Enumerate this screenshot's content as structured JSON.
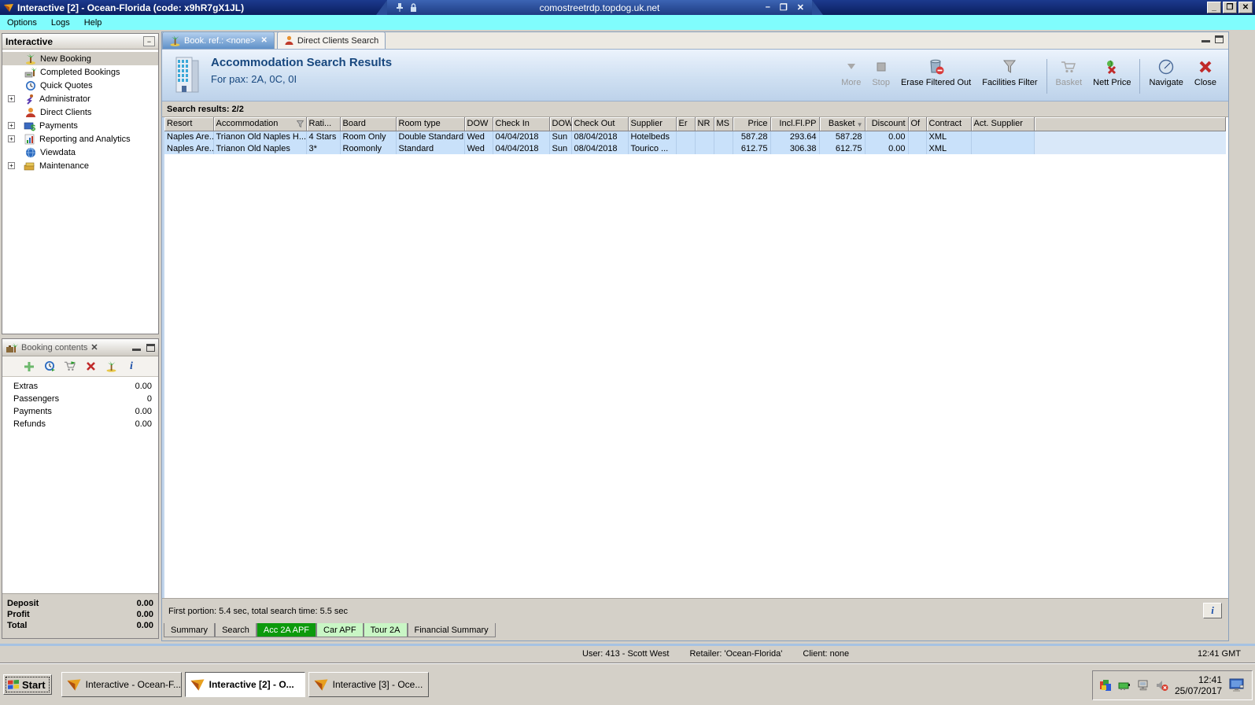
{
  "window": {
    "title": "Interactive [2] - Ocean-Florida (code: x9hR7gX1JL)"
  },
  "rdp": {
    "host": "comostreetrdp.topdog.uk.net"
  },
  "menu": {
    "items": [
      "Options",
      "Logs",
      "Help"
    ]
  },
  "sidebar": {
    "title": "Interactive",
    "items": [
      {
        "label": "New Booking"
      },
      {
        "label": "Completed Bookings"
      },
      {
        "label": "Quick Quotes"
      },
      {
        "label": "Administrator"
      },
      {
        "label": "Direct Clients"
      },
      {
        "label": "Payments"
      },
      {
        "label": "Reporting and Analytics"
      },
      {
        "label": "Viewdata"
      },
      {
        "label": "Maintenance"
      }
    ]
  },
  "booking_contents": {
    "title": "Booking contents",
    "rows": [
      {
        "label": "Extras",
        "value": "0.00"
      },
      {
        "label": "Passengers",
        "value": "0"
      },
      {
        "label": "Payments",
        "value": "0.00"
      },
      {
        "label": "Refunds",
        "value": "0.00"
      }
    ],
    "totals": [
      {
        "label": "Deposit",
        "value": "0.00"
      },
      {
        "label": "Profit",
        "value": "0.00"
      },
      {
        "label": "Total",
        "value": "0.00"
      }
    ]
  },
  "tabs": [
    {
      "label": "Book. ref.: <none>"
    },
    {
      "label": "Direct Clients Search"
    }
  ],
  "header": {
    "title": "Accommodation Search Results",
    "subtitle": "For pax: 2A, 0C, 0I"
  },
  "toolbar": {
    "items": [
      {
        "label": "More"
      },
      {
        "label": "Stop"
      },
      {
        "label": "Erase Filtered Out"
      },
      {
        "label": "Facilities Filter"
      },
      {
        "label": "Basket"
      },
      {
        "label": "Nett Price"
      },
      {
        "label": "Navigate"
      },
      {
        "label": "Close"
      }
    ]
  },
  "results": {
    "label": "Search results: 2/2",
    "columns": [
      "Resort",
      "Accommodation",
      "Rati...",
      "Board",
      "Room type",
      "DOW",
      "Check In",
      "DOW",
      "Check Out",
      "Supplier",
      "Er",
      "NR",
      "MS",
      "Price",
      "Incl.Fl.PP",
      "Basket",
      "Discount",
      "Of",
      "Contract",
      "Act. Supplier"
    ],
    "rows": [
      {
        "cells": [
          "Naples Are...",
          "Trianon Old Naples H...",
          "4 Stars",
          "Room Only",
          "Double Standard",
          "Wed",
          "04/04/2018",
          "Sun",
          "08/04/2018",
          "Hotelbeds",
          "",
          "",
          "",
          "587.28",
          "293.64",
          "587.28",
          "0.00",
          "",
          "XML",
          ""
        ]
      },
      {
        "cells": [
          "Naples Are...",
          "Trianon Old Naples",
          "3*",
          "Roomonly",
          "Standard",
          "Wed",
          "04/04/2018",
          "Sun",
          "08/04/2018",
          "Tourico ...",
          "",
          "",
          "",
          "612.75",
          "306.38",
          "612.75",
          "0.00",
          "",
          "XML",
          ""
        ]
      }
    ]
  },
  "status_strip": {
    "text": "First portion: 5.4 sec, total search time: 5.5 sec",
    "info": "i"
  },
  "bottom_tabs": [
    {
      "label": "Summary"
    },
    {
      "label": "Search"
    },
    {
      "label": "Acc 2A APF"
    },
    {
      "label": "Car APF"
    },
    {
      "label": "Tour 2A"
    },
    {
      "label": "Financial Summary"
    }
  ],
  "status_bar": {
    "user": "User: 413 - Scott West",
    "retailer": "Retailer: 'Ocean-Florida'",
    "client": "Client: none",
    "time": "12:41 GMT"
  },
  "taskbar": {
    "start": "Start",
    "buttons": [
      {
        "label": "Interactive - Ocean-F..."
      },
      {
        "label": "Interactive [2] - O..."
      },
      {
        "label": "Interactive [3] - Oce..."
      }
    ],
    "tray": {
      "time": "12:41",
      "date": "25/07/2017"
    }
  }
}
